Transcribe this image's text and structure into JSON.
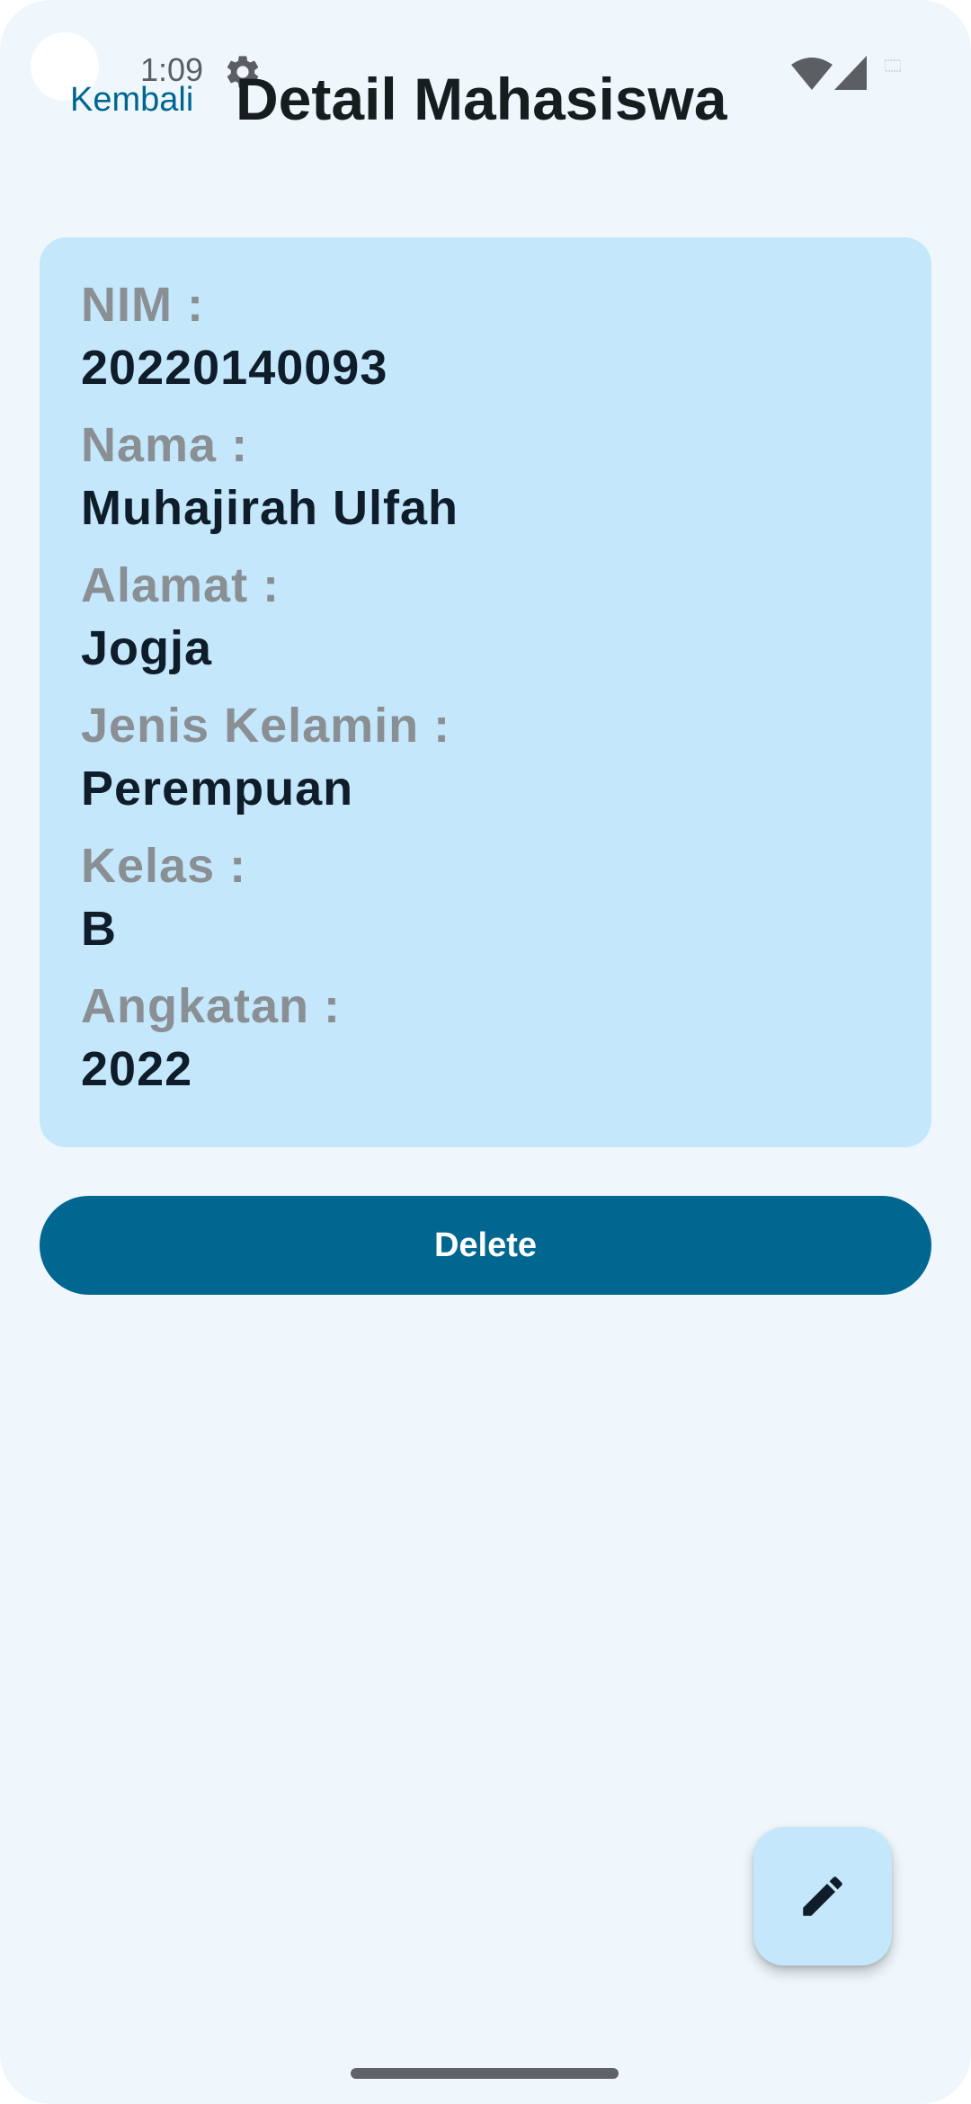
{
  "status_bar": {
    "time": "1:09",
    "gear_icon": "gear-icon",
    "wifi_icon": "wifi-icon",
    "signal_icon": "cell-signal-icon",
    "battery_icon": "battery-icon"
  },
  "app_bar": {
    "back_label": "Kembali",
    "title": "Detail Mahasiswa"
  },
  "detail": {
    "fields": [
      {
        "label": "NIM :",
        "value": "20220140093"
      },
      {
        "label": "Nama :",
        "value": "Muhajirah Ulfah"
      },
      {
        "label": "Alamat :",
        "value": "Jogja"
      },
      {
        "label": "Jenis Kelamin :",
        "value": "Perempuan"
      },
      {
        "label": "Kelas :",
        "value": "B"
      },
      {
        "label": "Angkatan :",
        "value": "2022"
      }
    ]
  },
  "actions": {
    "delete_label": "Delete",
    "fab_icon": "edit-pencil-icon"
  },
  "colors": {
    "background": "#eff7fd",
    "card": "#c4e7fc",
    "primary": "#016690",
    "label": "#8a8f94",
    "value": "#0f1d2a",
    "title": "#171c1f"
  }
}
